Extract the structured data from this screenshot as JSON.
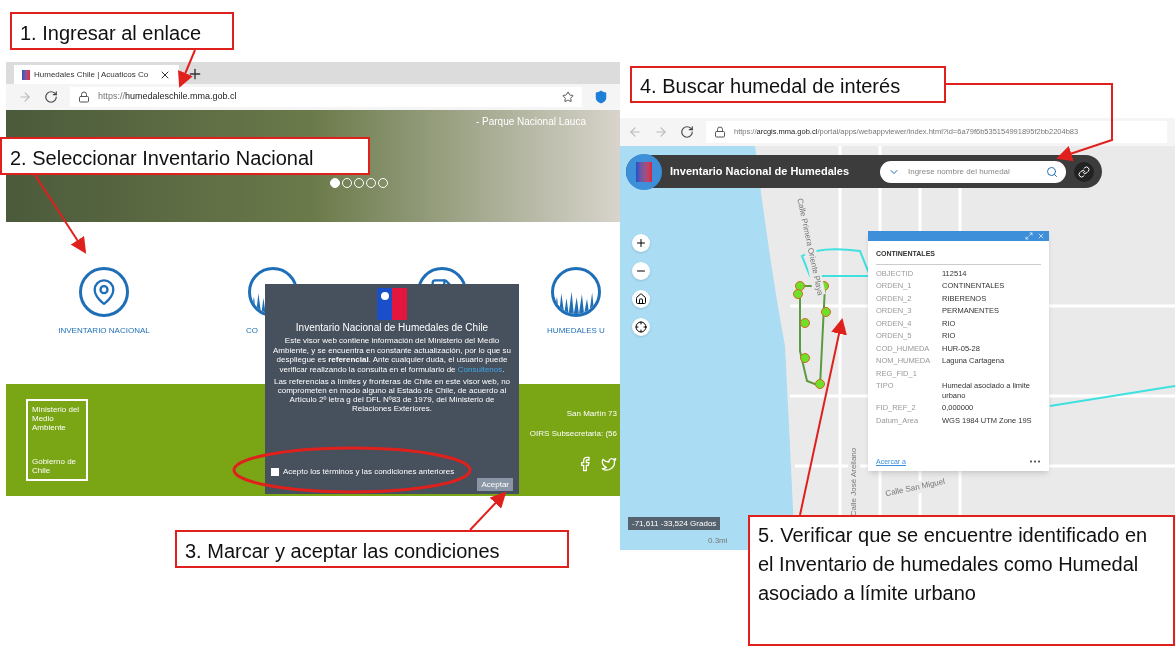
{
  "callouts": [
    {
      "text": "1. Ingresar al enlace"
    },
    {
      "text": "2. Seleccionar Inventario Nacional"
    },
    {
      "text": "3. Marcar y aceptar las condiciones"
    },
    {
      "text": "4. Buscar humedal de interés"
    },
    {
      "text": "5. Verificar que se encuentre identificado en el Inventario de humedales como Humedal asociado a límite urbano"
    }
  ],
  "left_browser": {
    "tab_title": "Humedales Chile | Acuaticos Co",
    "url_scheme": "https://",
    "url_domain": "humedaleschile.mma.gob.cl",
    "banner_caption": "- Parque Nacional Lauca",
    "carousel_dots": [
      {
        "selected": true
      },
      {
        "selected": false
      },
      {
        "selected": false
      },
      {
        "selected": false
      },
      {
        "selected": false
      }
    ],
    "sections": [
      {
        "kind": "map",
        "label": "INVENTARIO NACIONAL"
      },
      {
        "kind": "grass",
        "label": "CO"
      },
      {
        "kind": "document"
      },
      {
        "kind": "grass",
        "label": "HUMEDALES U"
      }
    ],
    "footer": {
      "ministry": "Ministerio del Medio Ambiente",
      "government": "Gobierno de Chile",
      "address": "San Martín 73",
      "oirs": "OIRS Subsecretaria: (56"
    }
  },
  "modal": {
    "title": "Inventario Nacional de Humedales de Chile",
    "paragraph": "Este visor web contiene información del Ministerio del Medio Ambiente, y se encuentra en constante actualización, por lo que su despliegue es **referencial**. Ante cualquier duda, el usuario puede verificar realizando la consulta en el formulario de",
    "link": "Consultenos",
    "paragraph_end": ".",
    "note": "Las referencias a límites y fronteras de Chile en este visor web, no comprometen en modo alguno al Estado de Chile, de acuerdo al Artículo 2º letra g del DFL Nº83 de 1979, del Ministerio de Relaciones Exteriores.",
    "checkbox": {
      "label": "Acepto los términos y las condiciones anteriores",
      "checked": false
    },
    "button": {
      "label": "Aceptar",
      "disabled": true
    }
  },
  "right_browser": {
    "url_scheme": "https://",
    "url_domain": "arcgis.mma.gob.cl",
    "url_path": "/portal/apps/webappviewer/index.html?id=6a79f6b535154991895f2bb2204b83",
    "app_title": "Inventario Nacional de Humedales",
    "search": {
      "placeholder": "Ingrese nombre del humedal"
    },
    "street_labels": [
      "Calle Primera Oriente Playa",
      "Calle José Arellano",
      "Calle San Miguel"
    ],
    "popup": {
      "title": "CONTINENTALES",
      "rows": [
        {
          "field": "OBJECTID",
          "value": "112514"
        },
        {
          "field": "ORDEN_1",
          "value": "CONTINENTALES"
        },
        {
          "field": "ORDEN_2",
          "value": "RIBERENOS"
        },
        {
          "field": "ORDEN_3",
          "value": "PERMANENTES"
        },
        {
          "field": "ORDEN_4",
          "value": "RIO"
        },
        {
          "field": "ORDEN_5",
          "value": "RIO"
        },
        {
          "field": "COD_HUMEDA",
          "value": "HUR-05-28"
        },
        {
          "field": "NOM_HUMEDA",
          "value": "Laguna Cartagena"
        },
        {
          "field": "REG_FID_1"
        },
        {
          "field": "TIPO",
          "value": "Humedal asociado a limite urbano"
        },
        {
          "field": "FID_REF_2",
          "value": "0,000000"
        },
        {
          "field": "Datum_Area",
          "value": "WGS 1984 UTM Zone 19S"
        }
      ],
      "link": "Acercar a"
    },
    "coordinates": "-71,611 -33,524 Grados",
    "scale": "0.3mi"
  }
}
